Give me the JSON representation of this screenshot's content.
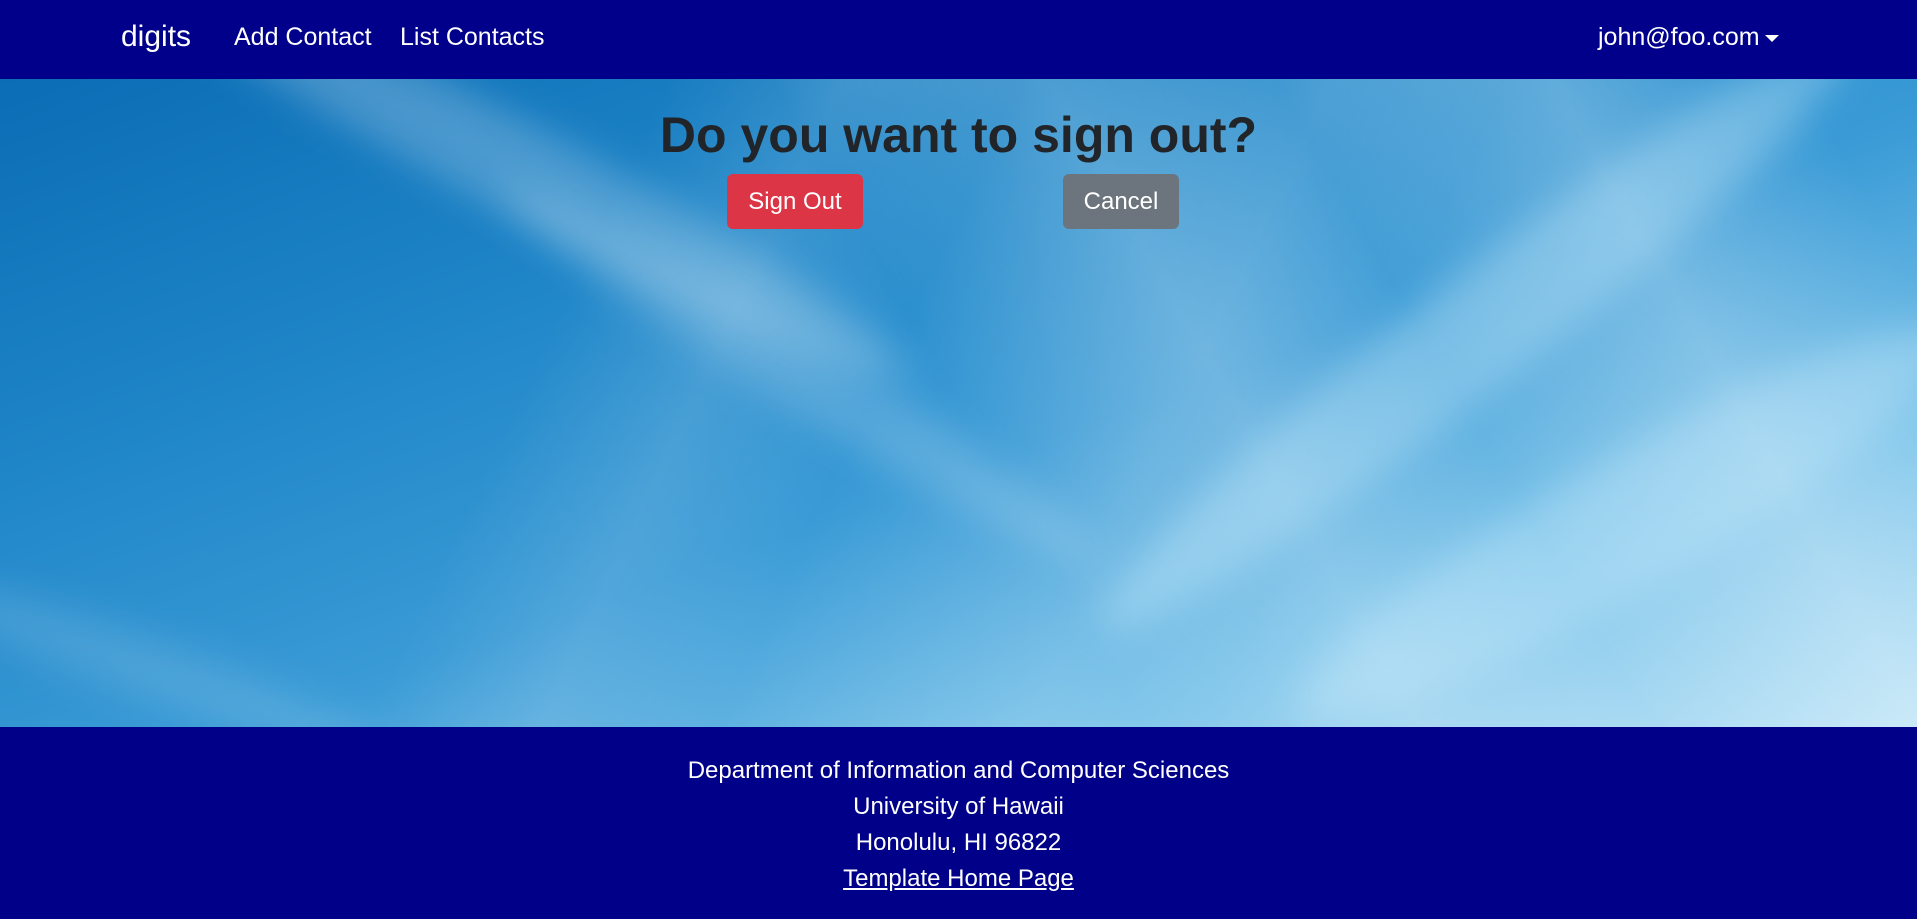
{
  "navbar": {
    "brand": "digits",
    "links": [
      {
        "label": "Add Contact"
      },
      {
        "label": "List Contacts"
      }
    ],
    "user": "john@foo.com"
  },
  "main": {
    "title": "Do you want to sign out?",
    "sign_out_label": "Sign Out",
    "cancel_label": "Cancel"
  },
  "footer": {
    "line1": "Department of Information and Computer Sciences",
    "line2": "University of Hawaii",
    "line3": "Honolulu, HI 96822",
    "link": "Template Home Page"
  },
  "colors": {
    "navbar": "#00008b",
    "footer": "#000088",
    "danger": "#dc3545",
    "secondary": "#6c757d",
    "title_text": "#212529"
  },
  "icons": {
    "user_menu": "caret-down-icon"
  }
}
